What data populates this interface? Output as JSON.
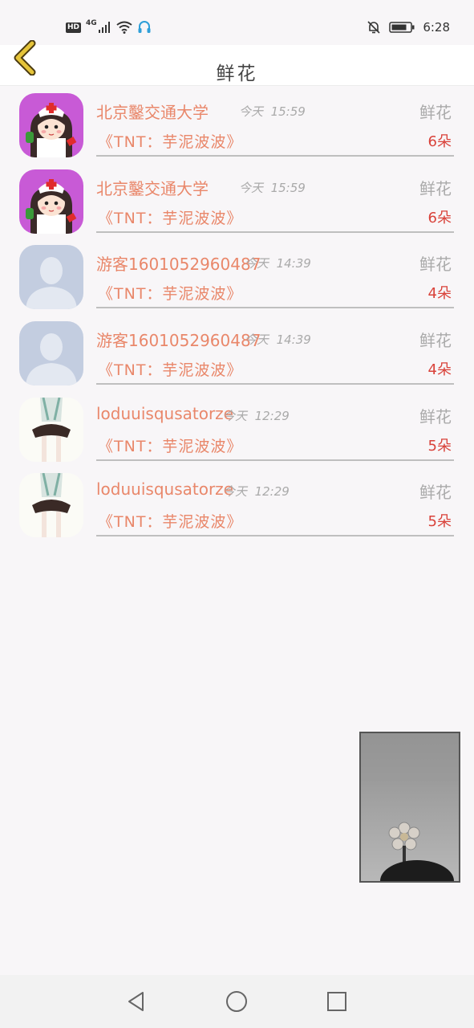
{
  "status_bar": {
    "hd_label": "HD",
    "network_label": "4G",
    "time": "6:28",
    "icons": [
      "signal-icon",
      "wifi-icon",
      "headset-app-icon",
      "bell-muted-icon",
      "battery-icon"
    ]
  },
  "header": {
    "title": "鲜花",
    "back_icon": "chevron-left-icon",
    "accent_color": "#e5c43a"
  },
  "gifts": [
    {
      "avatar": "nurse-avatar",
      "name": "北京鑿交通大学",
      "day": "今天",
      "time": "15:59",
      "type": "鲜花",
      "gift": "《TNT：芋泥波波》",
      "count": "6朵"
    },
    {
      "avatar": "nurse-avatar",
      "name": "北京鑿交通大学",
      "day": "今天",
      "time": "15:59",
      "type": "鲜花",
      "gift": "《TNT：芋泥波波》",
      "count": "6朵"
    },
    {
      "avatar": "default-avatar",
      "name": "游客1601052960487",
      "day": "今天",
      "time": "14:39",
      "type": "鲜花",
      "gift": "《TNT：芋泥波波》",
      "count": "4朵"
    },
    {
      "avatar": "default-avatar",
      "name": "游客1601052960487",
      "day": "今天",
      "time": "14:39",
      "type": "鲜花",
      "gift": "《TNT：芋泥波波》",
      "count": "4朵"
    },
    {
      "avatar": "girl-avatar",
      "name": "loduuisqusatorze",
      "day": "今天",
      "time": "12:29",
      "type": "鲜花",
      "gift": "《TNT：芋泥波波》",
      "count": "5朵"
    },
    {
      "avatar": "girl-avatar",
      "name": "loduuisqusatorze",
      "day": "今天",
      "time": "12:29",
      "type": "鲜花",
      "gift": "《TNT：芋泥波波》",
      "count": "5朵"
    }
  ],
  "colors": {
    "name": "#e9876a",
    "count": "#d9423a",
    "muted": "#aaaaaa",
    "background": "#f8f6f8"
  },
  "nav_bar": {
    "buttons": [
      "back-triangle-icon",
      "home-circle-icon",
      "recents-square-icon"
    ]
  }
}
